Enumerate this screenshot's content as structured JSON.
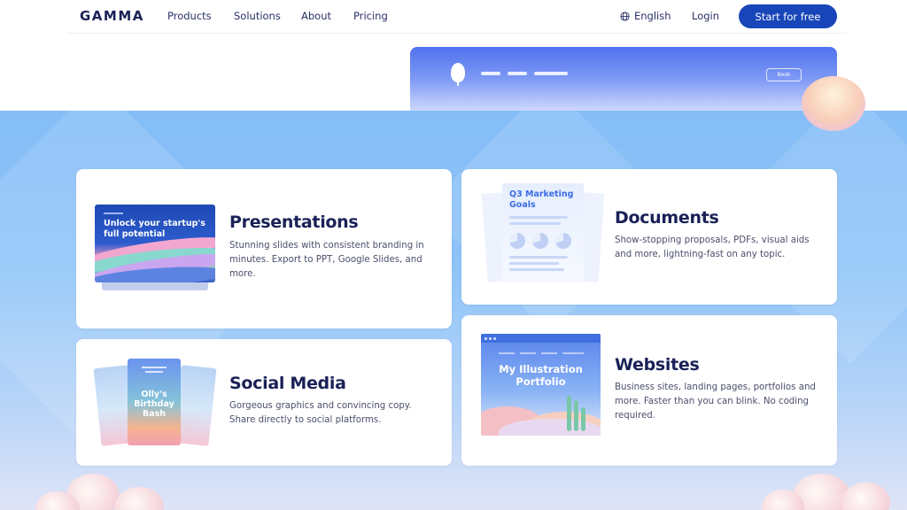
{
  "nav": {
    "logo": "GAMMA",
    "links": [
      "Products",
      "Solutions",
      "About",
      "Pricing"
    ],
    "language": "English",
    "login": "Login",
    "cta": "Start for free",
    "icons": {
      "language": "globe-icon"
    }
  },
  "preview": {
    "book_label": "Book"
  },
  "cards": {
    "presentations": {
      "title": "Presentations",
      "description": "Stunning slides with consistent branding in minutes. Export to PPT, Google Slides, and more.",
      "thumb_text": "Unlock your startup's full potential"
    },
    "documents": {
      "title": "Documents",
      "description": "Show-stopping proposals, PDFs, visual aids and more, lightning-fast on any topic.",
      "thumb_text": "Q3 Marketing Goals"
    },
    "social": {
      "title": "Social Media",
      "description": "Gorgeous graphics and convincing copy. Share directly to social platforms.",
      "thumb_text": "Olly's Birthday Bash"
    },
    "websites": {
      "title": "Websites",
      "description": "Business sites, landing pages, portfolios and more. Faster than you can blink. No coding required.",
      "thumb_text": "My Illustration Portfolio"
    }
  },
  "colors": {
    "brand_navy": "#1a2157",
    "cta_blue": "#1846b8",
    "section_blue": "#85bdf7"
  }
}
